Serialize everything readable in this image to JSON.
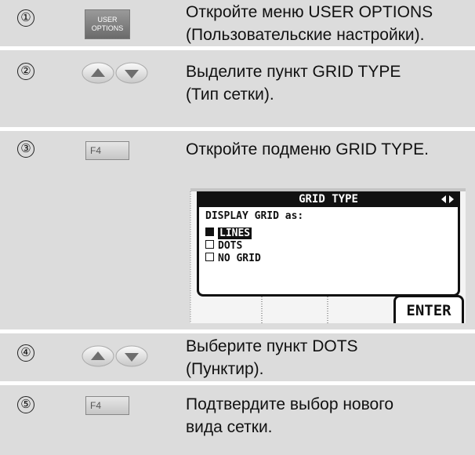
{
  "steps": [
    {
      "marker": "①",
      "key": "USER OPTIONS",
      "key_lines": [
        "USER",
        "OPTIONS"
      ],
      "lines": [
        "Откройте меню USER OPTIONS",
        "(Пользовательские настройки)."
      ]
    },
    {
      "marker": "②",
      "key": "up-down-arrows",
      "lines": [
        "Выделите пункт GRID TYPE",
        "(Тип сетки)."
      ]
    },
    {
      "marker": "③",
      "key": "F4",
      "lines": [
        "Откройте подменю GRID TYPE."
      ]
    },
    {
      "marker": "④",
      "key": "up-down-arrows",
      "lines": [
        "Выберите пункт DOTS",
        "(Пунктир)."
      ]
    },
    {
      "marker": "⑤",
      "key": "F4",
      "lines": [
        "Подтвердите выбор нового",
        "вида сетки."
      ]
    }
  ],
  "screen": {
    "title": "GRID TYPE",
    "nav_icon": "left-right-arrows-icon",
    "prompt": "DISPLAY GRID as:",
    "options": [
      {
        "label": "LINES",
        "checked": true
      },
      {
        "label": "DOTS",
        "checked": false
      },
      {
        "label": "NO GRID",
        "checked": false
      }
    ],
    "softkey": "ENTER"
  }
}
